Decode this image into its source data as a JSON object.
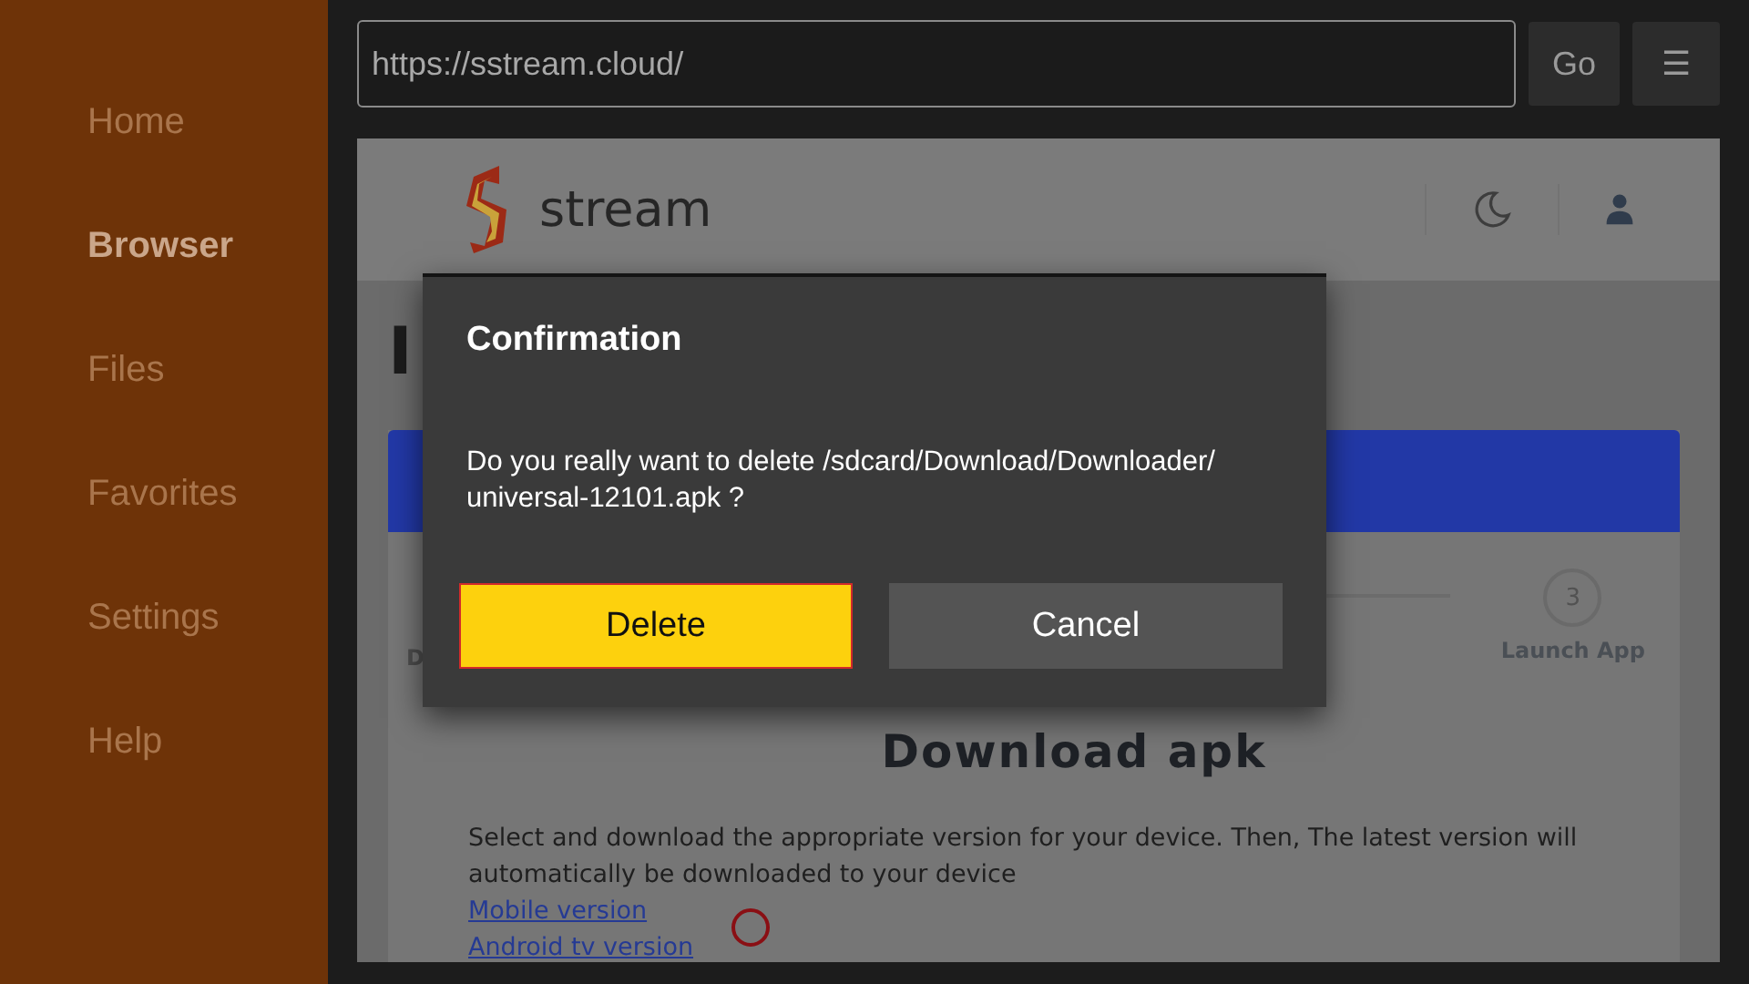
{
  "sidebar": {
    "items": [
      {
        "label": "Home",
        "selected": false
      },
      {
        "label": "Browser",
        "selected": true
      },
      {
        "label": "Files",
        "selected": false
      },
      {
        "label": "Favorites",
        "selected": false
      },
      {
        "label": "Settings",
        "selected": false
      },
      {
        "label": "Help",
        "selected": false
      }
    ]
  },
  "url_bar": {
    "value": "https://sstream.cloud/"
  },
  "toolbar": {
    "go": "Go",
    "menu": "☰"
  },
  "page": {
    "logo_text": "stream",
    "heading": "I",
    "step_left_label": "D",
    "step_right": {
      "number": "3",
      "label": "Launch App"
    },
    "title": "Download apk",
    "text": "Select and download the appropriate version for your device. Then, The latest version will automatically be downloaded to your device",
    "links": [
      "Mobile version",
      "Android tv version"
    ]
  },
  "dialog": {
    "title": "Confirmation",
    "message_lines": [
      "Do you really want to delete /sdcard/Download/Downloader/",
      "universal-12101.apk ?"
    ],
    "buttons": [
      {
        "label": "Delete",
        "kind": "primary",
        "selected": true
      },
      {
        "label": "Cancel",
        "kind": "secondary",
        "selected": false
      }
    ]
  }
}
